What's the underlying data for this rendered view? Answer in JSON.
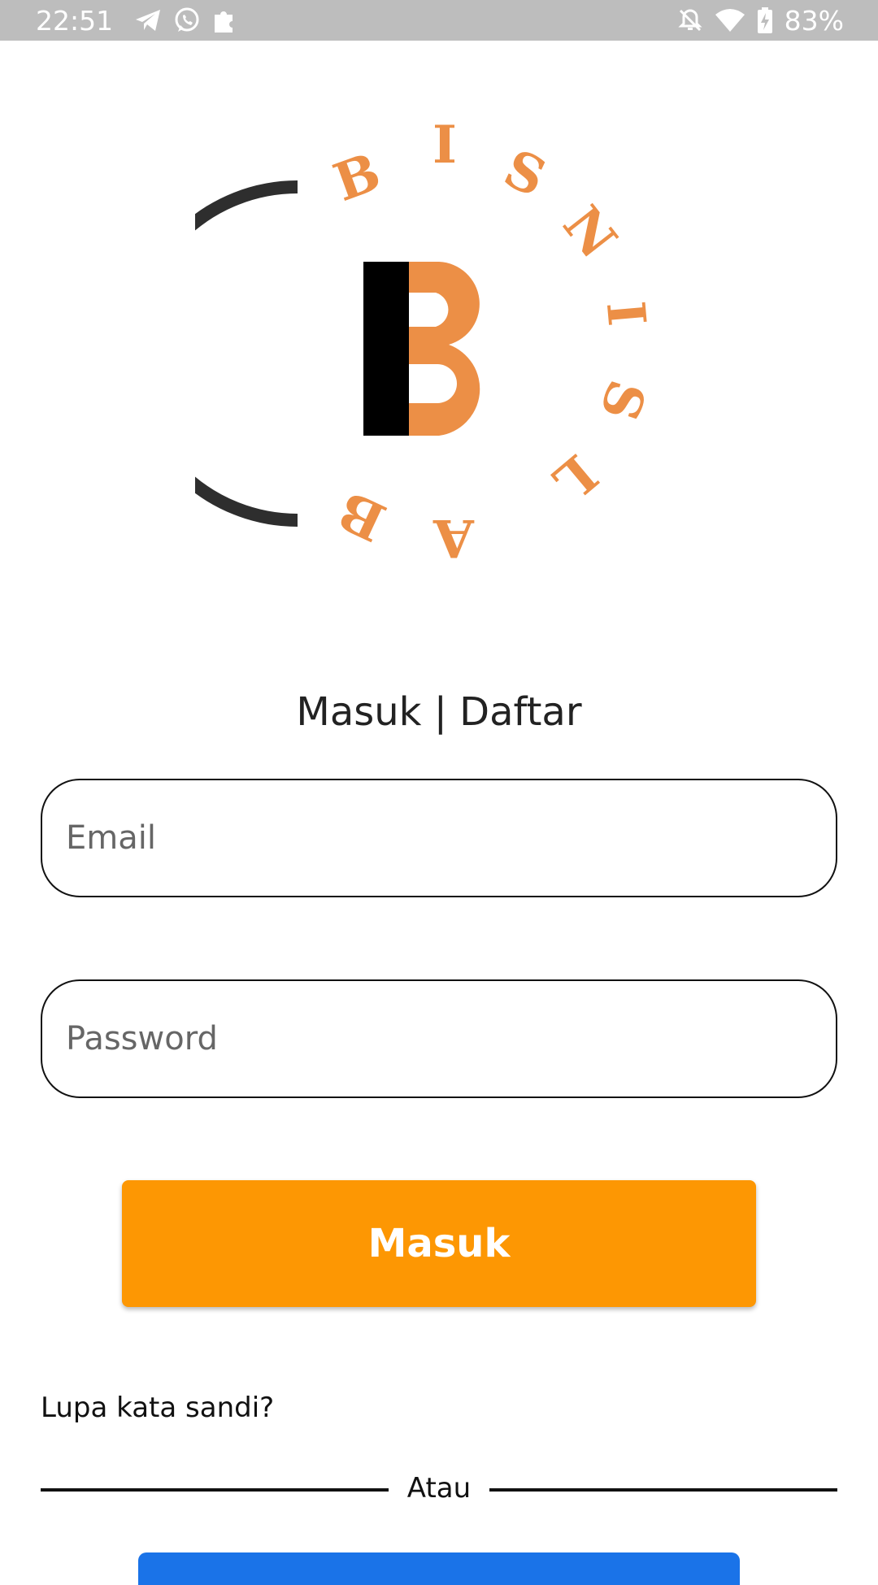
{
  "status_bar": {
    "time": "22:51",
    "battery": "83%",
    "icons_left": [
      "telegram-icon",
      "whatsapp-icon",
      "puzzle-icon"
    ],
    "icons_right": [
      "bell-off-icon",
      "wifi-icon",
      "battery-charging-icon"
    ]
  },
  "logo": {
    "center_letter": "B",
    "ring_letters": [
      "B",
      "I",
      "S",
      "N",
      "I",
      "S",
      "L",
      "A",
      "B"
    ],
    "colors": {
      "orange": "#ec8f46",
      "dark": "#2e2e2e",
      "black": "#000000"
    }
  },
  "title": "Masuk | Daftar",
  "form": {
    "email_placeholder": "Email",
    "password_placeholder": "Password"
  },
  "primary_button": {
    "label": "Masuk",
    "color": "#fd9703"
  },
  "forgot_password": "Lupa kata sandi?",
  "divider_text": "Atau",
  "secondary_button": {
    "color": "#1a73e8"
  }
}
